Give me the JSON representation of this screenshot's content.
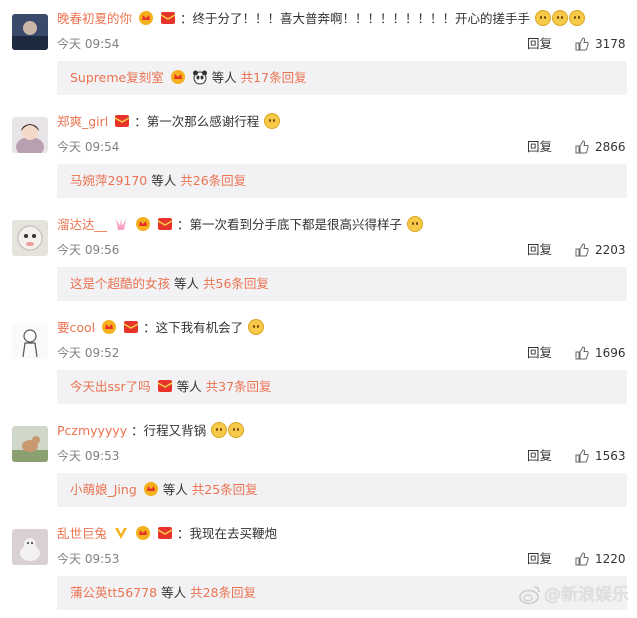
{
  "comments": [
    {
      "username": "晚春初夏的你",
      "separator": "：",
      "text": "终于分了！！！喜大普奔啊！！！！！！！！！开心的搓手手",
      "time": "今天 09:54",
      "reply_label": "回复",
      "likes": "3178",
      "reply_user": "Supreme复刻室",
      "reply_etc": "等人",
      "reply_count": "共17条回复"
    },
    {
      "username": "郑爽_girl",
      "separator": "：",
      "text": "第一次那么感谢行程",
      "time": "今天 09:54",
      "reply_label": "回复",
      "likes": "2866",
      "reply_user": "马婉萍29170",
      "reply_etc": "等人",
      "reply_count": "共26条回复"
    },
    {
      "username": "溜达达__",
      "separator": "：",
      "text": "第一次看到分手底下都是很高兴得样子",
      "time": "今天 09:56",
      "reply_label": "回复",
      "likes": "2203",
      "reply_user": "这是个超酷的女孩",
      "reply_etc": "等人",
      "reply_count": "共56条回复"
    },
    {
      "username": "要cool",
      "separator": "：",
      "text": "这下我有机会了",
      "time": "今天 09:52",
      "reply_label": "回复",
      "likes": "1696",
      "reply_user": "今天出ssr了吗",
      "reply_etc": "等人",
      "reply_count": "共37条回复"
    },
    {
      "username": "Pczmyyyyy",
      "separator": "：",
      "text": "行程又背锅",
      "time": "今天 09:53",
      "reply_label": "回复",
      "likes": "1563",
      "reply_user": "小萌娘_Jing",
      "reply_etc": "等人",
      "reply_count": "共25条回复"
    },
    {
      "username": "乱世巨兔",
      "separator": "：",
      "text": "我现在去买鞭炮",
      "time": "今天 09:53",
      "reply_label": "回复",
      "likes": "1220",
      "reply_user": "蒲公英tt56778",
      "reply_etc": "等人",
      "reply_count": "共28条回复"
    }
  ],
  "watermark": "@新浪娱乐",
  "colors": {
    "username": "#eb7350",
    "reply_bg": "#f2f2f5",
    "meta": "#808080",
    "badge_red": "#e8332a",
    "badge_gold": "#f5b11d"
  },
  "icons": {
    "like": "thumbs-up-icon",
    "member_badge": "crown-badge-icon",
    "redpacket_badge": "red-envelope-icon",
    "emoji": "smile-emoji-icon"
  }
}
